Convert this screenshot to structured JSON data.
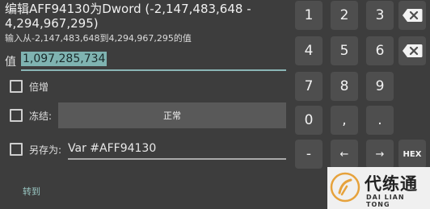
{
  "dialog": {
    "title": "编辑AFF94130为Dword (-2,147,483,648 - 4,294,967,295)",
    "hint": "输入从-2,147,483,648到4,294,967,295的值",
    "value_label": "值",
    "value": "1,097,285,734",
    "increment_label": "倍增",
    "freeze_label": "冻结:",
    "freeze_mode": "正常",
    "saveas_label": "另存为:",
    "saveas_value": "Var #AFF94130",
    "goto_label": "转到"
  },
  "keypad": {
    "keys": [
      "1",
      "2",
      "3",
      "4",
      "5",
      "6",
      "7",
      "8",
      "9",
      "0",
      ",",
      ".",
      "-",
      "←",
      "→",
      "HEX"
    ]
  },
  "watermark": {
    "title": "代练通",
    "subtitle": "DAI LIAN TONG"
  }
}
